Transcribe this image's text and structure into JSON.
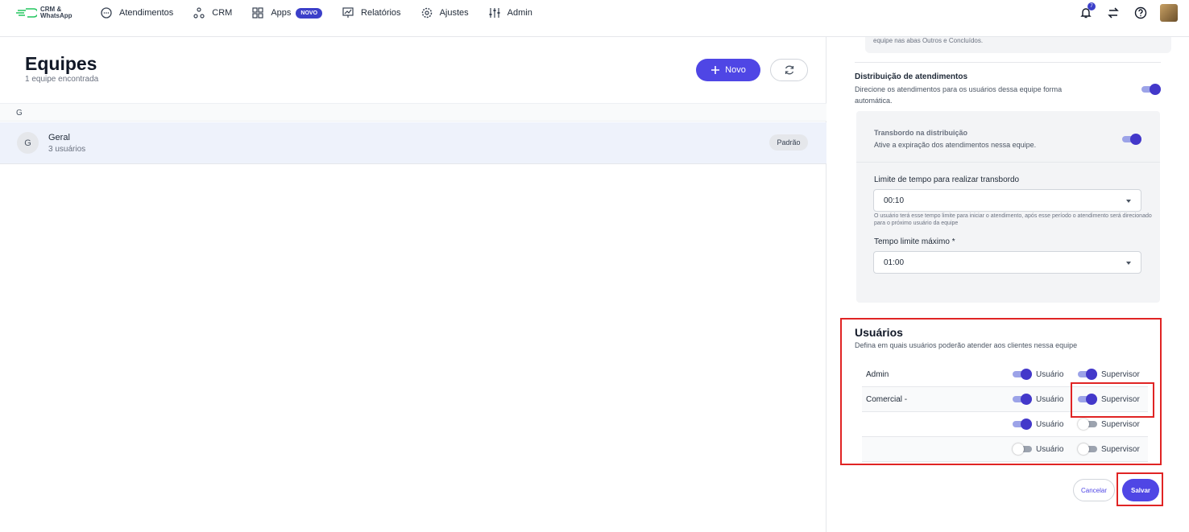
{
  "logo": {
    "line1": "CRM &",
    "line2": "WhatsApp"
  },
  "nav": {
    "items": [
      {
        "label": "Atendimentos",
        "icon": "chat-bubble-icon"
      },
      {
        "label": "CRM",
        "icon": "nodes-icon"
      },
      {
        "label": "Apps",
        "icon": "grid-icon",
        "badge": "NOVO"
      },
      {
        "label": "Relatórios",
        "icon": "presentation-chart-icon"
      },
      {
        "label": "Ajustes",
        "icon": "gear-icon"
      },
      {
        "label": "Admin",
        "icon": "sliders-icon"
      }
    ],
    "notification_count": "7"
  },
  "teams": {
    "title": "Equipes",
    "subtitle": "1 equipe encontrada",
    "new_button": "Novo",
    "group_letter": "G",
    "rows": [
      {
        "avatar": "G",
        "name": "Geral",
        "users": "3 usuários",
        "badge": "Padrão"
      }
    ]
  },
  "form": {
    "info_text": "equipe nas abas Outros e Concluídos.",
    "distribution": {
      "title": "Distribuição de atendimentos",
      "desc": "Direcione os atendimentos para os usuários dessa equipe forma automática.",
      "enabled": true
    },
    "overflow": {
      "title": "Transbordo na distribuição",
      "desc": "Ative a expiração dos atendimentos nessa equipe.",
      "enabled": true
    },
    "time_limit": {
      "label": "Limite de tempo para realizar transbordo",
      "value": "00:10",
      "hint": "O usuário terá esse tempo limite para iniciar o atendimento, após esse período o atendimento será direcionado para o próximo usuário da equipe"
    },
    "max_time": {
      "label": "Tempo limite máximo *",
      "value": "01:00"
    },
    "users": {
      "title": "Usuários",
      "desc": "Defina em quais usuários poderão atender aos clientes nessa equipe",
      "user_label": "Usuário",
      "supervisor_label": "Supervisor",
      "rows": [
        {
          "name": "Admin",
          "usuario": true,
          "supervisor": true
        },
        {
          "name": "Comercial -",
          "usuario": true,
          "supervisor": true
        },
        {
          "name": "",
          "usuario": true,
          "supervisor": false
        },
        {
          "name": "",
          "usuario": false,
          "supervisor": false
        }
      ]
    },
    "cancel_button": "Cancelar",
    "save_button": "Salvar"
  },
  "colors": {
    "accent": "#4f46e5",
    "highlight": "#e02424"
  }
}
